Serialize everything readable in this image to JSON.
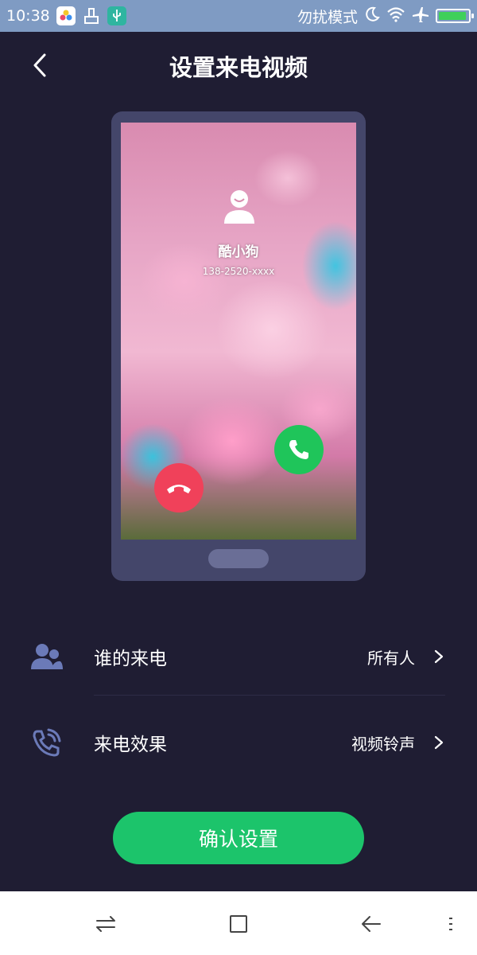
{
  "status_bar": {
    "time": "10:38",
    "dnd_label": "勿扰模式",
    "icons": [
      "gallery-app-icon",
      "cleaner-icon",
      "usb-icon",
      "moon-icon",
      "wifi-icon",
      "airplane-icon",
      "battery-icon"
    ],
    "battery_level": 0.95
  },
  "header": {
    "title": "设置来电视频",
    "back_icon": "back-arrow-icon"
  },
  "preview": {
    "caller_name": "酷小狗",
    "caller_number": "138-2520-xxxx",
    "answer_color": "#1fc55a",
    "decline_color": "#f0415a"
  },
  "settings": [
    {
      "icon": "contacts-icon",
      "label": "谁的来电",
      "value": "所有人"
    },
    {
      "icon": "incoming-call-icon",
      "label": "来电效果",
      "value": "视频铃声"
    }
  ],
  "confirm": {
    "label": "确认设置",
    "color": "#1cc46b"
  },
  "nav_bar": {
    "icons": [
      "switch-icon",
      "home-square-icon",
      "back-icon",
      "menu-icon"
    ]
  }
}
